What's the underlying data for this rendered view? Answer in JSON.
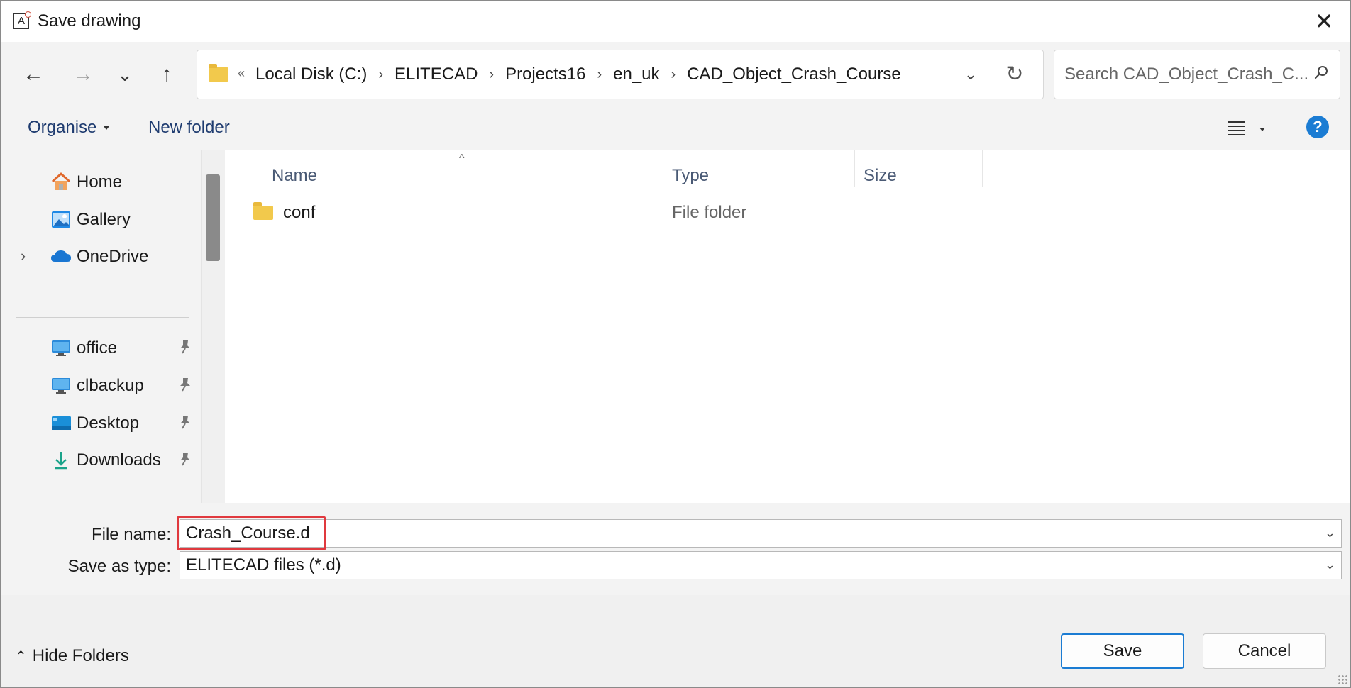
{
  "window": {
    "title": "Save drawing",
    "close_label": "✕",
    "app_icon_letter": "A"
  },
  "navigation": {
    "back": "←",
    "forward": "→",
    "recent": "⌄",
    "up": "↑",
    "address_prefix": "«",
    "breadcrumbs": [
      "Local Disk (C:)",
      "ELITECAD",
      "Projects16",
      "en_uk",
      "CAD_Object_Crash_Course"
    ],
    "crumb_separator": "›",
    "search_placeholder": "Search CAD_Object_Crash_C..."
  },
  "commands": {
    "organise": "Organise",
    "new_folder": "New folder",
    "help": "?"
  },
  "sidebar": {
    "items": [
      {
        "label": "Home",
        "icon": "home-icon"
      },
      {
        "label": "Gallery",
        "icon": "gallery-icon"
      },
      {
        "label": "OneDrive",
        "icon": "onedrive-icon",
        "expandable": true
      },
      {
        "label": "office",
        "icon": "computer-icon",
        "pinned": true
      },
      {
        "label": "clbackup",
        "icon": "computer-icon",
        "pinned": true
      },
      {
        "label": "Desktop",
        "icon": "desktop-icon",
        "pinned": true
      },
      {
        "label": "Downloads",
        "icon": "download-icon",
        "pinned": true
      }
    ]
  },
  "file_list": {
    "columns": [
      "Name",
      "Type",
      "Size"
    ],
    "rows": [
      {
        "name": "conf",
        "type": "File folder",
        "size": ""
      }
    ]
  },
  "form": {
    "file_name_label": "File name:",
    "file_name_value": "Crash_Course.d",
    "save_type_label": "Save as type:",
    "save_type_value": "ELITECAD files (*.d)"
  },
  "footer": {
    "hide_folders": "Hide Folders",
    "save": "Save",
    "cancel": "Cancel"
  },
  "colors": {
    "accent": "#1b7cd3",
    "highlight_box": "#e0393e",
    "folder": "#f2c94c"
  }
}
